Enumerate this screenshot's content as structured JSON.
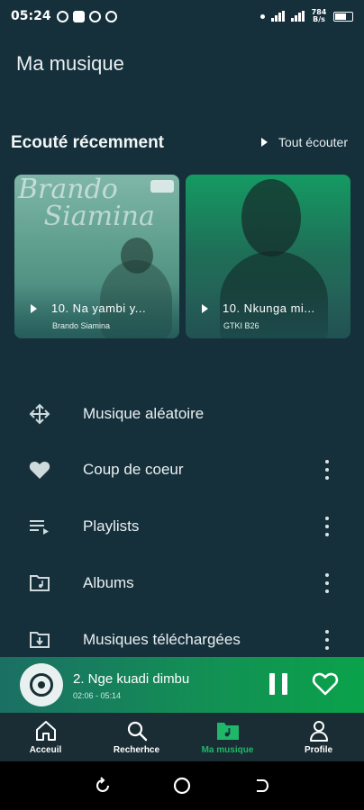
{
  "status_bar": {
    "time": "05:24",
    "network_speed": "784 B/s"
  },
  "header": {
    "title": "Ma musique"
  },
  "recent": {
    "title": "Ecouté récemment",
    "play_all_label": "Tout écouter",
    "cards": [
      {
        "title": "10. Na yambi y...",
        "artist": "Brando Siamina",
        "art_text": "Brando Siamina"
      },
      {
        "title": "10. Nkunga mi...",
        "artist": "GTKI B26"
      }
    ]
  },
  "menu": {
    "items": [
      {
        "label": "Musique aléatoire",
        "icon": "shuffle-icon",
        "has_more": false
      },
      {
        "label": "Coup de coeur",
        "icon": "heart-icon",
        "has_more": true
      },
      {
        "label": "Playlists",
        "icon": "playlist-icon",
        "has_more": true
      },
      {
        "label": "Albums",
        "icon": "album-folder-icon",
        "has_more": true
      },
      {
        "label": "Musiques téléchargées",
        "icon": "download-folder-icon",
        "has_more": true
      }
    ]
  },
  "player": {
    "track_title": "2. Nge kuadi dimbu",
    "time_display": "02:06 - 05:14"
  },
  "bottom_nav": {
    "items": [
      {
        "label": "Acceuil",
        "icon": "home-icon",
        "active": false
      },
      {
        "label": "Recherhce",
        "icon": "search-icon",
        "active": false
      },
      {
        "label": "Ma musique",
        "icon": "music-folder-icon",
        "active": true
      },
      {
        "label": "Profile",
        "icon": "user-icon",
        "active": false
      }
    ]
  },
  "colors": {
    "background": "#15303b",
    "accent": "#1fb86b",
    "player_gradient_start": "#1b6f64",
    "player_gradient_end": "#0aa24a",
    "nav_background": "#1a2d34"
  }
}
